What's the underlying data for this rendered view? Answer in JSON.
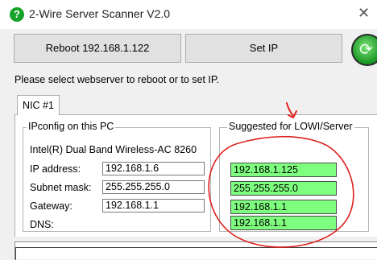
{
  "window": {
    "title": "2-Wire Server Scanner V2.0",
    "app_icon_glyph": "?"
  },
  "toolbar": {
    "reboot_label": "Reboot 192.168.1.122",
    "setip_label": "Set IP"
  },
  "instruction": "Please select webserver to reboot or to set IP.",
  "tabs": [
    {
      "label": "NIC #1"
    }
  ],
  "ipconfig": {
    "title": "IPconfig on this PC",
    "adapter": "Intel(R) Dual Band Wireless-AC 8260",
    "rows": [
      {
        "label": "IP address:",
        "value": "192.168.1.6"
      },
      {
        "label": "Subnet mask:",
        "value": "255.255.255.0"
      },
      {
        "label": "Gateway:",
        "value": "192.168.1.1"
      },
      {
        "label": "DNS:",
        "value": ""
      }
    ]
  },
  "suggested": {
    "title": "Suggested for LOWI/Server",
    "values": [
      "192.168.1.125",
      "255.255.255.0",
      "192.168.1.1",
      "192.168.1.1"
    ],
    "highlight_color": "#7fff7f"
  },
  "annotation_color": "#e0201c"
}
